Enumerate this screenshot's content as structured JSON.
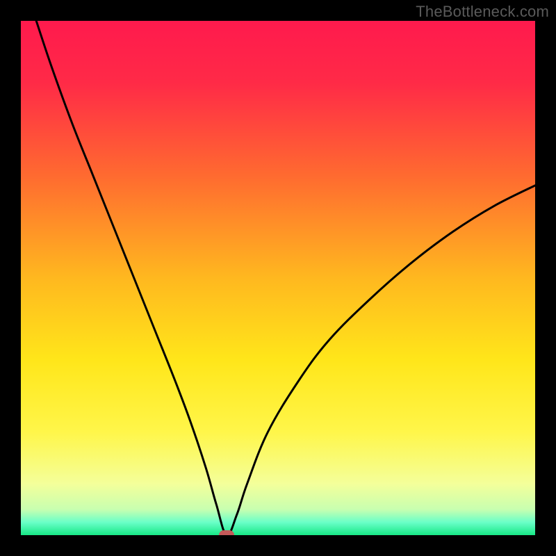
{
  "watermark": "TheBottleneck.com",
  "colors": {
    "frame": "#000000",
    "curve": "#000000",
    "marker": "#c45a5a",
    "gradient_stops": [
      {
        "offset": 0.0,
        "color": "#ff1a4d"
      },
      {
        "offset": 0.12,
        "color": "#ff2a47"
      },
      {
        "offset": 0.3,
        "color": "#ff6a30"
      },
      {
        "offset": 0.5,
        "color": "#ffb81f"
      },
      {
        "offset": 0.66,
        "color": "#ffe61a"
      },
      {
        "offset": 0.8,
        "color": "#fff64a"
      },
      {
        "offset": 0.9,
        "color": "#f4ff9a"
      },
      {
        "offset": 0.95,
        "color": "#c8ffb0"
      },
      {
        "offset": 0.975,
        "color": "#6affc8"
      },
      {
        "offset": 1.0,
        "color": "#17e886"
      }
    ]
  },
  "chart_data": {
    "type": "line",
    "title": "",
    "xlabel": "",
    "ylabel": "",
    "xlim": [
      0,
      100
    ],
    "ylim": [
      0,
      100
    ],
    "grid": false,
    "legend": false,
    "notes": "V-shaped bottleneck curve on a vertical red→green heat gradient. The curve descends from y=100 at x≈3 to a narrow minimum at x≈40 (y≈0), then rises concavely toward y≈68 at x=100. A small rounded red marker sits at the minimum.",
    "series": [
      {
        "name": "bottleneck-curve",
        "x": [
          3,
          6,
          10,
          14,
          18,
          22,
          26,
          30,
          33,
          36,
          38,
          40,
          42,
          44,
          48,
          54,
          60,
          68,
          76,
          84,
          92,
          100
        ],
        "y": [
          100,
          91,
          80,
          70,
          60,
          50,
          40,
          30,
          22,
          13,
          6,
          0,
          4,
          10,
          20,
          30,
          38,
          46,
          53,
          59,
          64,
          68
        ]
      }
    ],
    "marker": {
      "x": 40,
      "y": 0
    }
  }
}
